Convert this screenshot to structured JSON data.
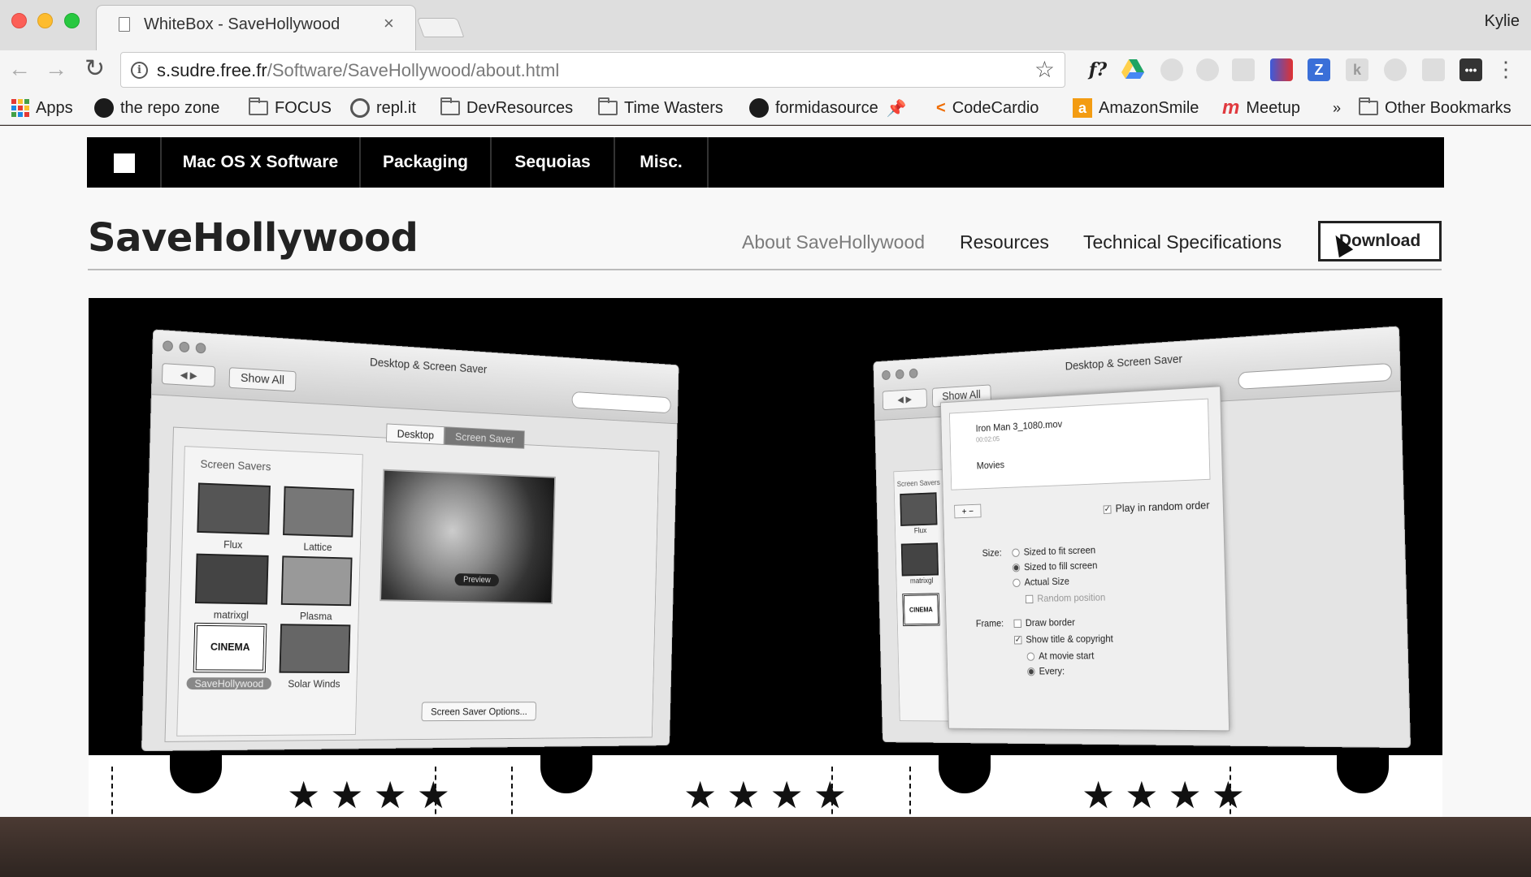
{
  "browser": {
    "tab_title": "WhiteBox - SaveHollywood",
    "tab_close": "×",
    "user_name": "Kylie",
    "url_host": "s.sudre.free.fr",
    "url_path": "/Software/SaveHollywood/about.html",
    "bookmarks": [
      {
        "label": "Apps",
        "icon": "apps-grid-icon"
      },
      {
        "label": "the repo zone",
        "icon": "github-icon"
      },
      {
        "label": "FOCUS",
        "icon": "folder-icon"
      },
      {
        "label": "repl.it",
        "icon": "replit-icon"
      },
      {
        "label": "DevResources",
        "icon": "folder-icon"
      },
      {
        "label": "Time Wasters",
        "icon": "folder-icon"
      },
      {
        "label": "formidasource",
        "icon": "github-icon"
      },
      {
        "label": "CodeCardio",
        "icon": "codecardio-icon"
      },
      {
        "label": "AmazonSmile",
        "icon": "amazon-icon"
      },
      {
        "label": "Meetup",
        "icon": "meetup-icon"
      }
    ],
    "bookmarks_overflow": "»",
    "other_bookmarks": "Other Bookmarks",
    "extensions_fx": "f?"
  },
  "site": {
    "nav": [
      "Mac OS X Software",
      "Packaging",
      "Sequoias",
      "Misc."
    ],
    "title": "SaveHollywood",
    "subnav": [
      "About SaveHollywood",
      "Resources",
      "Technical Specifications"
    ],
    "download": "Download"
  },
  "hero": {
    "left_window": {
      "title": "Desktop & Screen Saver",
      "show_all": "Show All",
      "tabs": [
        "Desktop",
        "Screen Saver"
      ],
      "list_header": "Screen Savers",
      "savers": [
        "Flux",
        "Lattice",
        "matrixgl",
        "Plasma",
        "SaveHollywood",
        "Solar Winds"
      ],
      "preview_button": "Preview",
      "options_button": "Screen Saver Options..."
    },
    "right_window": {
      "title": "Desktop & Screen Saver",
      "show_all": "Show All",
      "list_header": "Screen Savers",
      "savers": [
        "Flux",
        "matrixgl"
      ],
      "movie_file": "Iron Man 3_1080.mov",
      "movie_duration": "00:02:05",
      "movies_folder": "Movies",
      "random_order": "Play in random order",
      "size_label": "Size:",
      "size_options": [
        "Sized to fit screen",
        "Sized to fill screen",
        "Actual Size",
        "Random position"
      ],
      "frame_label": "Frame:",
      "frame_options": [
        "Draw border",
        "Show title & copyright",
        "At movie start",
        "Every:"
      ]
    },
    "ticket_text": "CINEMA",
    "star_rating": "★★★★"
  }
}
